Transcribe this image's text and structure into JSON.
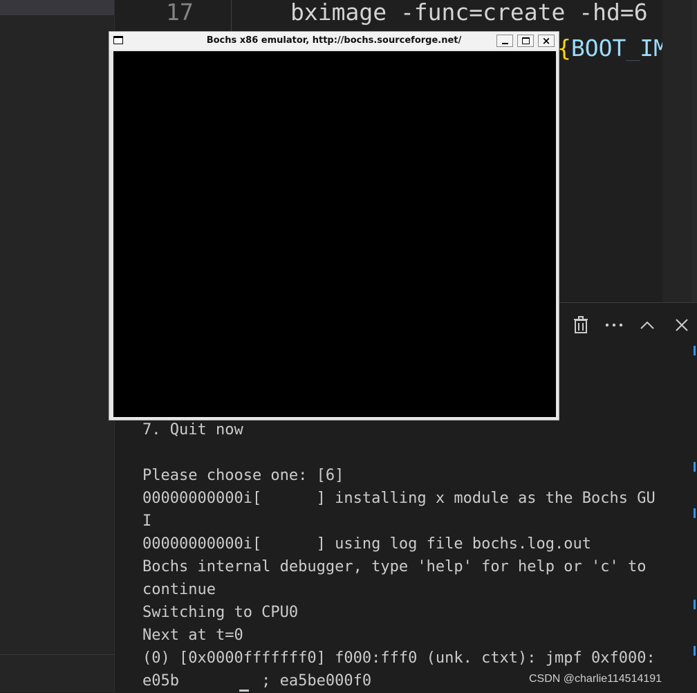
{
  "editor": {
    "line_number": "17",
    "code_line": "bximage -func=create -hd=6",
    "code_line2_brace": "{",
    "code_line2_var": "BOOT_IM"
  },
  "panel": {
    "icons": [
      "trash-icon",
      "more-icon",
      "chevron-up-icon",
      "close-icon"
    ]
  },
  "terminal": {
    "lines": [
      "7. Quit now",
      "",
      "Please choose one: [6]",
      "00000000000i[      ] installing x module as the Bochs GU",
      "I",
      "00000000000i[      ] using log file bochs.log.out",
      "Bochs internal debugger, type 'help' for help or 'c' to",
      "continue",
      "Switching to CPU0",
      "Next at t=0",
      "(0) [0x0000fffffff0] f000:fff0 (unk. ctxt): jmpf 0xf000:",
      "e05b         ; ea5be000f0"
    ]
  },
  "bochs": {
    "title": "Bochs x86 emulator, http://bochs.sourceforge.net/"
  },
  "watermark": "CSDN @charlie114514191"
}
